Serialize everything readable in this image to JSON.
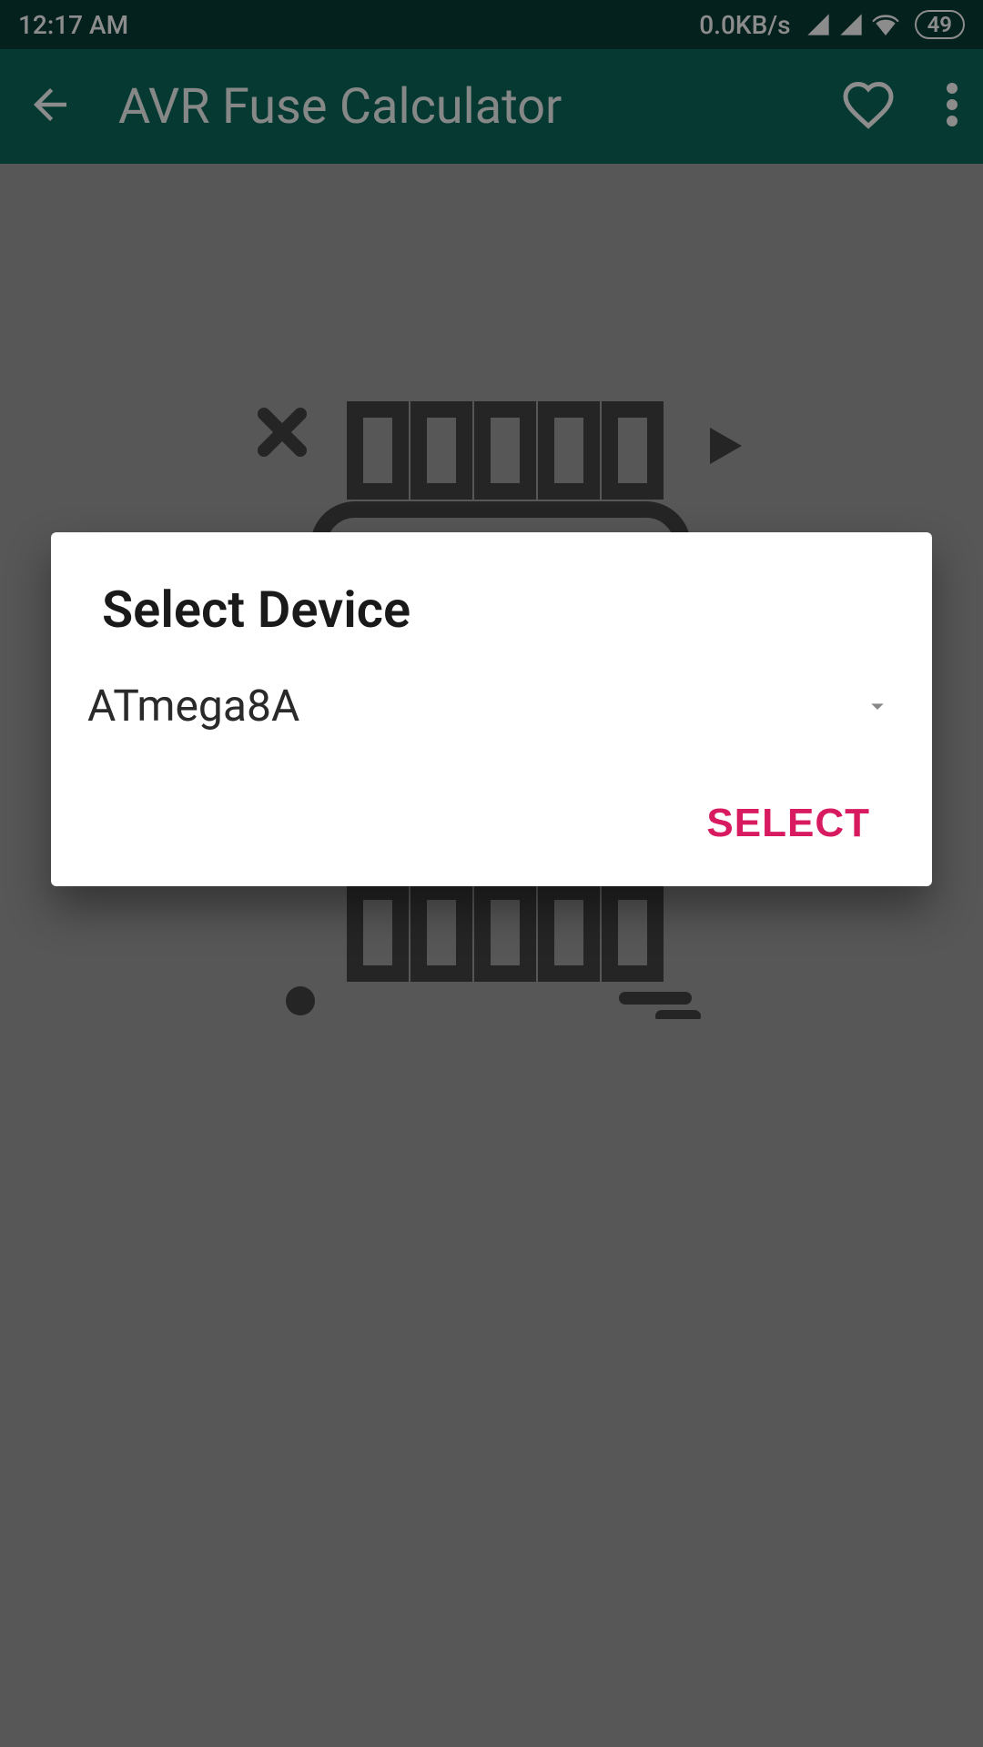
{
  "status_bar": {
    "time": "12:17 AM",
    "data_rate": "0.0KB/s",
    "battery": "49"
  },
  "app_bar": {
    "title": "AVR Fuse Calculator"
  },
  "dialog": {
    "title": "Select Device",
    "selected_value": "ATmega8A",
    "action_label": "SELECT"
  }
}
